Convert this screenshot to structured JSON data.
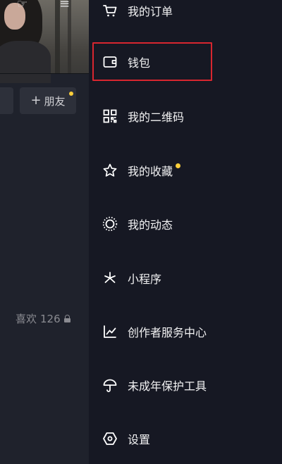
{
  "background": {
    "add_friend_label": "朋友",
    "likes_label": "喜欢",
    "likes_count": "126"
  },
  "menu": {
    "items": [
      {
        "id": "orders",
        "label": "我的订单",
        "icon": "cart-icon"
      },
      {
        "id": "wallet",
        "label": "钱包",
        "icon": "wallet-icon",
        "highlighted": true
      },
      {
        "id": "qrcode",
        "label": "我的二维码",
        "icon": "qrcode-icon"
      },
      {
        "id": "favorites",
        "label": "我的收藏",
        "icon": "star-icon",
        "badge": true
      },
      {
        "id": "moments",
        "label": "我的动态",
        "icon": "circle-dots-icon"
      },
      {
        "id": "mini-programs",
        "label": "小程序",
        "icon": "asterisk-icon"
      },
      {
        "id": "creator-center",
        "label": "创作者服务中心",
        "icon": "chart-icon"
      },
      {
        "id": "minor-protection",
        "label": "未成年保护工具",
        "icon": "umbrella-icon"
      },
      {
        "id": "settings",
        "label": "设置",
        "icon": "hexagon-gear-icon"
      }
    ]
  },
  "colors": {
    "drawer_bg": "#161823",
    "badge": "#fcce3a",
    "highlight_border": "#d8262f"
  }
}
